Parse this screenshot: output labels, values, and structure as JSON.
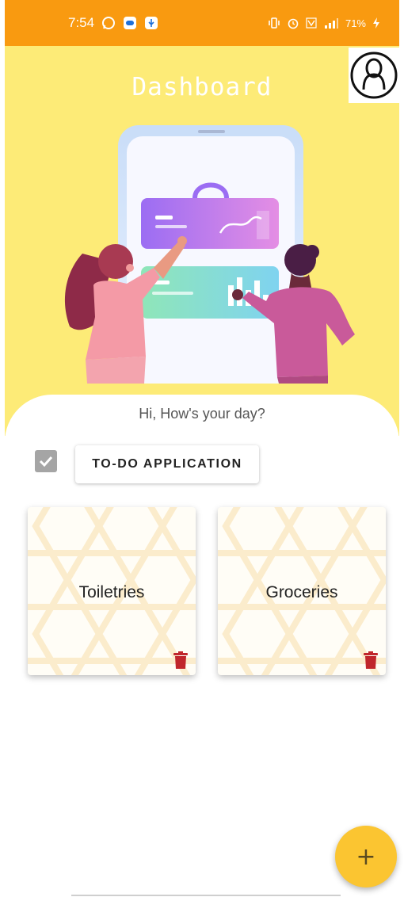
{
  "status_bar": {
    "time": "7:54",
    "battery_percent": "71%",
    "left_icons": [
      "whatsapp-icon",
      "discord-icon",
      "usb-icon"
    ],
    "right_icons": [
      "vibrate-icon",
      "alarm-icon",
      "volte-icon",
      "signal-4g-icon",
      "battery-charging-icon"
    ],
    "background_color": "#f99a10"
  },
  "header": {
    "title": "Dashboard",
    "background_color": "#fdeb77",
    "profile_icon": "profile-avatar-icon"
  },
  "greeting": "Hi, How's your day?",
  "todo": {
    "checked": true,
    "button_label": "TO-DO APPLICATION"
  },
  "cards": [
    {
      "label": "Toiletries",
      "action_icon": "delete-icon"
    },
    {
      "label": "Groceries",
      "action_icon": "delete-icon"
    }
  ],
  "fab": {
    "label": "+",
    "color": "#fbc531"
  },
  "colors": {
    "delete": "#c0262c",
    "checkbox": "#a5a5a5"
  }
}
